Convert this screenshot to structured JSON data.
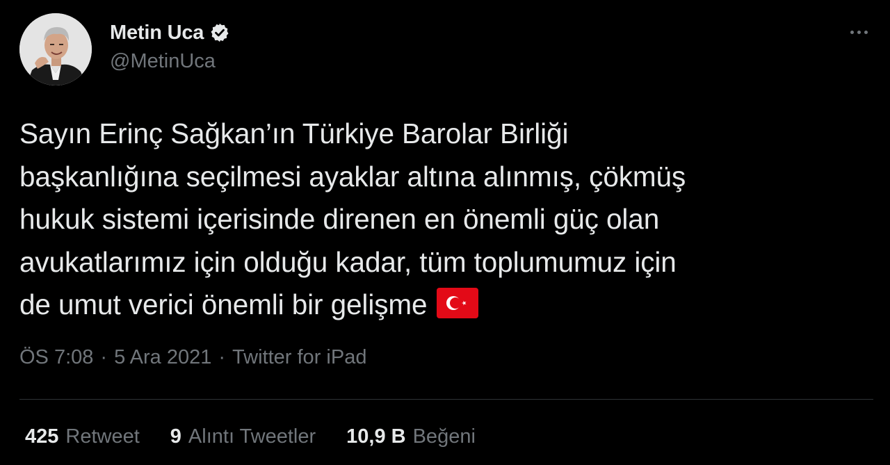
{
  "author": {
    "display_name": "Metin Uca",
    "handle": "@MetinUca",
    "verified": true,
    "avatar_icon": "profile-photo"
  },
  "tweet": {
    "lines": [
      "Sayın Erinç Sağkan’ın Türkiye Barolar Birliği",
      "başkanlığına seçilmesi ayaklar altına alınmış, çökmüş",
      "hukuk sistemi içerisinde direnen en önemli güç olan",
      "avukatlarımız için olduğu kadar, tüm toplumumuz için",
      "de umut verici önemli bir gelişme"
    ],
    "emoji": "turkey-flag-icon"
  },
  "meta": {
    "time": "ÖS 7:08",
    "separator": "·",
    "date": "5 Ara 2021",
    "source": "Twitter for iPad"
  },
  "stats": {
    "retweets": {
      "count": "425",
      "label": "Retweet"
    },
    "quotes": {
      "count": "9",
      "label": "Alıntı Tweetler"
    },
    "likes": {
      "count": "10,9 B",
      "label": "Beğeni"
    }
  },
  "colors": {
    "background": "#000000",
    "text_primary": "#e7e9ea",
    "text_secondary": "#71767b",
    "divider": "#2f3336",
    "flag_red": "#e30a17"
  }
}
